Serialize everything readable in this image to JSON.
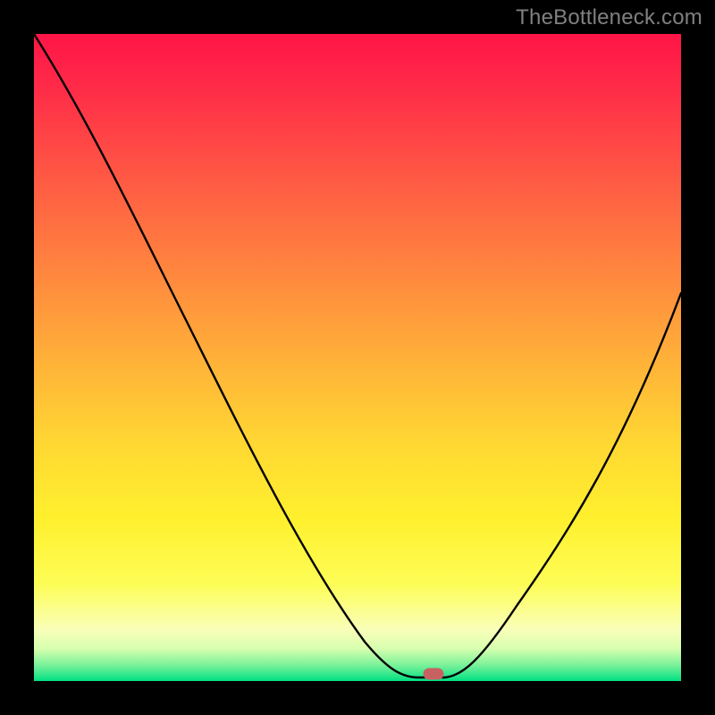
{
  "watermark": {
    "text": "TheBottleneck.com"
  },
  "chart_data": {
    "type": "line",
    "title": "",
    "xlabel": "",
    "ylabel": "",
    "xlim": [
      0,
      100
    ],
    "ylim": [
      0,
      100
    ],
    "series": [
      {
        "name": "bottleneck-curve",
        "x": [
          0,
          10,
          20,
          30,
          40,
          50,
          56,
          60,
          62,
          64,
          70,
          80,
          90,
          100
        ],
        "values": [
          100,
          85,
          69,
          52,
          35,
          17,
          3,
          0,
          0,
          1,
          11,
          29,
          47,
          60
        ]
      }
    ],
    "annotations": [
      {
        "name": "optimal-marker",
        "x": 61,
        "y": 0.7
      }
    ],
    "background_gradient_stops": [
      {
        "pos": 0.0,
        "color": "#ff1547"
      },
      {
        "pos": 0.5,
        "color": "#ffb638"
      },
      {
        "pos": 0.85,
        "color": "#fdfd56"
      },
      {
        "pos": 1.0,
        "color": "#00e083"
      }
    ]
  }
}
